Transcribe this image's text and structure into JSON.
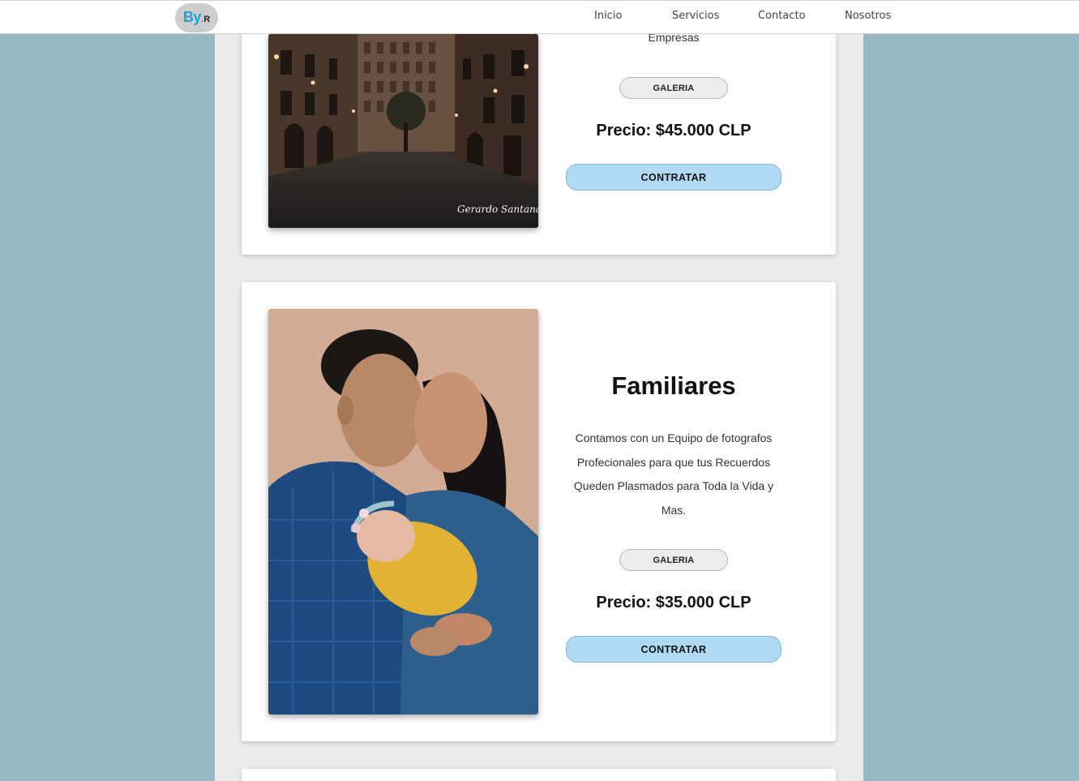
{
  "nav": {
    "logo_main": "By",
    "logo_dot": ".",
    "logo_sub": "R",
    "links": [
      "Inicio",
      "Servicios",
      "Contacto",
      "Nosotros"
    ]
  },
  "cards": [
    {
      "desc_tail": "Empresas",
      "gallery_label": "GALERIA",
      "price": "Precio: $45.000 CLP",
      "hire_label": "CONTRATAR",
      "photo_signature": "Gerardo Santana"
    },
    {
      "title": "Familiares",
      "desc_lines": [
        "Contamos con un Equipo de fotografos",
        "Profecionales para que tus Recuerdos",
        "Queden Plasmados para Toda la Vida y",
        "Mas."
      ],
      "gallery_label": "GALERIA",
      "price": "Precio: $35.000 CLP",
      "hire_label": "CONTRATAR"
    }
  ],
  "colors": {
    "page_bg": "#97b9c4",
    "column_bg": "#ebebeb",
    "accent": "#1f9fd6",
    "hire_button": "#b0d9f6"
  },
  "icons": {
    "photo_1": "city-street-photo",
    "photo_2": "family-newborn-photo"
  }
}
